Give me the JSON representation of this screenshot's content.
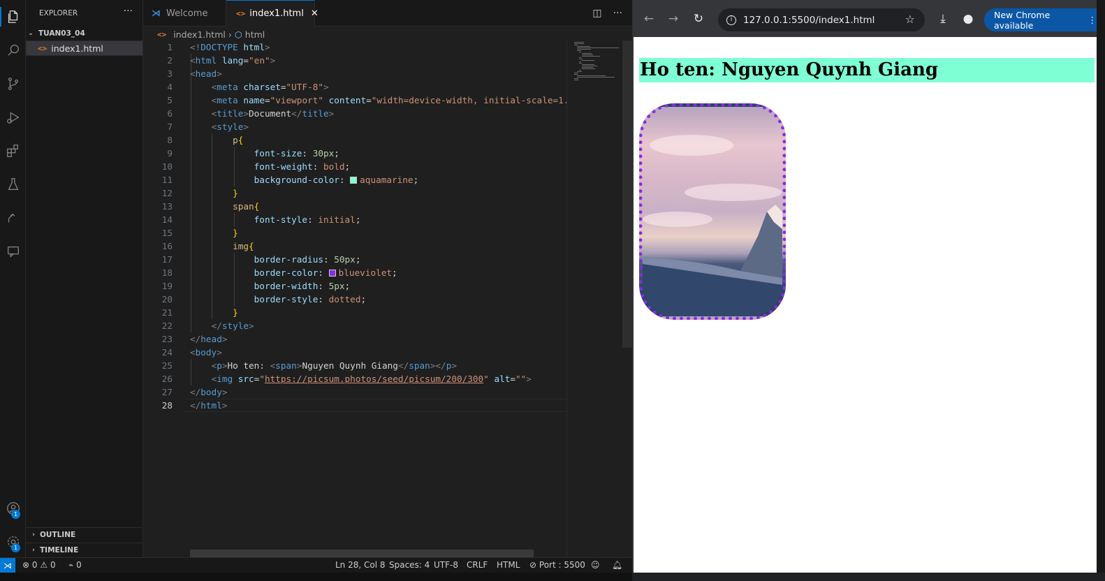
{
  "explorer": {
    "title": "EXPLORER",
    "more": "···",
    "folder": "TUAN03_04",
    "files": [
      "index1.html"
    ],
    "outline": "OUTLINE",
    "timeline": "TIMELINE"
  },
  "activity_badges": {
    "accounts": "1",
    "manage": "1"
  },
  "tabs": [
    {
      "label": "Welcome",
      "active": false
    },
    {
      "label": "index1.html",
      "active": true
    }
  ],
  "breadcrumb": {
    "file": "index1.html",
    "node": "html"
  },
  "code": {
    "current_line": 28,
    "lines": [
      [
        [
          "t",
          "<!"
        ],
        [
          "tg",
          "DOCTYPE"
        ],
        [
          "tx",
          " "
        ],
        [
          "at",
          "html"
        ],
        [
          "t",
          ">"
        ]
      ],
      [
        [
          "t",
          "<"
        ],
        [
          "tg",
          "html"
        ],
        [
          "tx",
          " "
        ],
        [
          "at",
          "lang"
        ],
        [
          "tx",
          "="
        ],
        [
          "st",
          "\"en\""
        ],
        [
          "t",
          ">"
        ]
      ],
      [
        [
          "t",
          "<"
        ],
        [
          "tg",
          "head"
        ],
        [
          "t",
          ">"
        ]
      ],
      [
        [
          "tx",
          "    "
        ],
        [
          "t",
          "<"
        ],
        [
          "tg",
          "meta"
        ],
        [
          "tx",
          " "
        ],
        [
          "at",
          "charset"
        ],
        [
          "tx",
          "="
        ],
        [
          "st",
          "\"UTF-8\""
        ],
        [
          "t",
          ">"
        ]
      ],
      [
        [
          "tx",
          "    "
        ],
        [
          "t",
          "<"
        ],
        [
          "tg",
          "meta"
        ],
        [
          "tx",
          " "
        ],
        [
          "at",
          "name"
        ],
        [
          "tx",
          "="
        ],
        [
          "st",
          "\"viewport\""
        ],
        [
          "tx",
          " "
        ],
        [
          "at",
          "content"
        ],
        [
          "tx",
          "="
        ],
        [
          "st",
          "\"width=device-width, initial-scale=1."
        ]
      ],
      [
        [
          "tx",
          "    "
        ],
        [
          "t",
          "<"
        ],
        [
          "tg",
          "title"
        ],
        [
          "t",
          ">"
        ],
        [
          "tx",
          "Document"
        ],
        [
          "t",
          "</"
        ],
        [
          "tg",
          "title"
        ],
        [
          "t",
          ">"
        ]
      ],
      [
        [
          "tx",
          "    "
        ],
        [
          "t",
          "<"
        ],
        [
          "tg",
          "style"
        ],
        [
          "t",
          ">"
        ]
      ],
      [
        [
          "tx",
          "        "
        ],
        [
          "sel",
          "p"
        ],
        [
          "br",
          "{"
        ]
      ],
      [
        [
          "tx",
          "            "
        ],
        [
          "pr",
          "font-size"
        ],
        [
          "pn",
          ": "
        ],
        [
          "num",
          "30px"
        ],
        [
          "pn",
          ";"
        ]
      ],
      [
        [
          "tx",
          "            "
        ],
        [
          "pr",
          "font-weight"
        ],
        [
          "pn",
          ": "
        ],
        [
          "val",
          "bold"
        ],
        [
          "pn",
          ";"
        ]
      ],
      [
        [
          "tx",
          "            "
        ],
        [
          "pr",
          "background-color"
        ],
        [
          "pn",
          ": "
        ],
        [
          "sw:#7fffd4",
          ""
        ],
        [
          "val",
          "aquamarine"
        ],
        [
          "pn",
          ";"
        ]
      ],
      [
        [
          "tx",
          "        "
        ],
        [
          "br",
          "}"
        ]
      ],
      [
        [
          "tx",
          "        "
        ],
        [
          "sel",
          "span"
        ],
        [
          "br",
          "{"
        ]
      ],
      [
        [
          "tx",
          "            "
        ],
        [
          "pr",
          "font-style"
        ],
        [
          "pn",
          ": "
        ],
        [
          "val",
          "initial"
        ],
        [
          "pn",
          ";"
        ]
      ],
      [
        [
          "tx",
          "        "
        ],
        [
          "br",
          "}"
        ]
      ],
      [
        [
          "tx",
          "        "
        ],
        [
          "sel",
          "img"
        ],
        [
          "br",
          "{"
        ]
      ],
      [
        [
          "tx",
          "            "
        ],
        [
          "pr",
          "border-radius"
        ],
        [
          "pn",
          ": "
        ],
        [
          "num",
          "50px"
        ],
        [
          "pn",
          ";"
        ]
      ],
      [
        [
          "tx",
          "            "
        ],
        [
          "pr",
          "border-color"
        ],
        [
          "pn",
          ": "
        ],
        [
          "sw:#8a2be2",
          ""
        ],
        [
          "val",
          "blueviolet"
        ],
        [
          "pn",
          ";"
        ]
      ],
      [
        [
          "tx",
          "            "
        ],
        [
          "pr",
          "border-width"
        ],
        [
          "pn",
          ": "
        ],
        [
          "num",
          "5px"
        ],
        [
          "pn",
          ";"
        ]
      ],
      [
        [
          "tx",
          "            "
        ],
        [
          "pr",
          "border-style"
        ],
        [
          "pn",
          ": "
        ],
        [
          "val",
          "dotted"
        ],
        [
          "pn",
          ";"
        ]
      ],
      [
        [
          "tx",
          "        "
        ],
        [
          "br",
          "}"
        ]
      ],
      [
        [
          "tx",
          "    "
        ],
        [
          "t",
          "</"
        ],
        [
          "tg",
          "style"
        ],
        [
          "t",
          ">"
        ]
      ],
      [
        [
          "t",
          "</"
        ],
        [
          "tg",
          "head"
        ],
        [
          "t",
          ">"
        ]
      ],
      [
        [
          "t",
          "<"
        ],
        [
          "tg",
          "body"
        ],
        [
          "t",
          ">"
        ]
      ],
      [
        [
          "tx",
          "    "
        ],
        [
          "t",
          "<"
        ],
        [
          "tg",
          "p"
        ],
        [
          "t",
          ">"
        ],
        [
          "tx",
          "Ho ten: "
        ],
        [
          "t",
          "<"
        ],
        [
          "tg",
          "span"
        ],
        [
          "t",
          ">"
        ],
        [
          "tx",
          "Nguyen Quynh Giang"
        ],
        [
          "t",
          "</"
        ],
        [
          "tg",
          "span"
        ],
        [
          "t",
          "></"
        ],
        [
          "tg",
          "p"
        ],
        [
          "t",
          ">"
        ]
      ],
      [
        [
          "tx",
          "    "
        ],
        [
          "t",
          "<"
        ],
        [
          "tg",
          "img"
        ],
        [
          "tx",
          " "
        ],
        [
          "at",
          "src"
        ],
        [
          "tx",
          "="
        ],
        [
          "st",
          "\""
        ],
        [
          "stu",
          "https://picsum.photos/seed/picsum/200/300"
        ],
        [
          "st",
          "\""
        ],
        [
          "tx",
          " "
        ],
        [
          "at",
          "alt"
        ],
        [
          "tx",
          "="
        ],
        [
          "st",
          "\"\""
        ],
        [
          "t",
          ">"
        ]
      ],
      [
        [
          "t",
          "</"
        ],
        [
          "tg",
          "body"
        ],
        [
          "t",
          ">"
        ]
      ],
      [
        [
          "t",
          "</"
        ],
        [
          "tg",
          "html"
        ],
        [
          "t",
          ">"
        ]
      ]
    ]
  },
  "status": {
    "errors": "0",
    "warnings": "0",
    "ports": "0",
    "position": "Ln 28, Col 8",
    "spaces": "Spaces: 4",
    "encoding": "UTF-8",
    "eol": "CRLF",
    "language": "HTML",
    "port": "Port : 5500"
  },
  "browser": {
    "url": "127.0.0.1:5500/index1.html",
    "update_label": "New Chrome available",
    "page": {
      "paragraph": "Ho ten: Nguyen Quynh Giang"
    }
  },
  "colors": {
    "accent": "#0078d4",
    "aquamarine": "#7fffd4",
    "blueviolet": "#8a2be2"
  }
}
